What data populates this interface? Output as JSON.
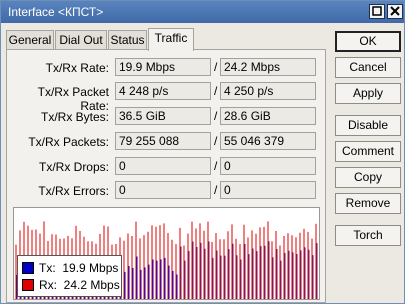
{
  "window": {
    "title": "Interface <КПСТ>"
  },
  "tabs": [
    {
      "label": "General"
    },
    {
      "label": "Dial Out"
    },
    {
      "label": "Status"
    },
    {
      "label": "Traffic"
    }
  ],
  "fields": [
    {
      "label": "Tx/Rx Rate:",
      "tx": "19.9 Mbps",
      "rx": "24.2 Mbps"
    },
    {
      "label": "Tx/Rx Packet Rate:",
      "tx": "4 248 p/s",
      "rx": "4 250 p/s"
    },
    {
      "label": "Tx/Rx Bytes:",
      "tx": "36.5 GiB",
      "rx": "28.6 GiB"
    },
    {
      "label": "Tx/Rx Packets:",
      "tx": "79 255 088",
      "rx": "55 046 379"
    },
    {
      "label": "Tx/Rx Drops:",
      "tx": "0",
      "rx": "0"
    },
    {
      "label": "Tx/Rx Errors:",
      "tx": "0",
      "rx": "0"
    }
  ],
  "separator": "/",
  "legend": {
    "tx": {
      "label": "Tx:",
      "value": "19.9 Mbps",
      "color": "#0000c8"
    },
    "rx": {
      "label": "Rx:",
      "value": "24.2 Mbps",
      "color": "#e00000"
    }
  },
  "buttons": {
    "ok": "OK",
    "cancel": "Cancel",
    "apply": "Apply",
    "disable": "Disable",
    "comment": "Comment",
    "copy": "Copy",
    "remove": "Remove",
    "torch": "Torch"
  },
  "graph_colors": {
    "tx": "#0000c8",
    "rx": "#e00000"
  }
}
